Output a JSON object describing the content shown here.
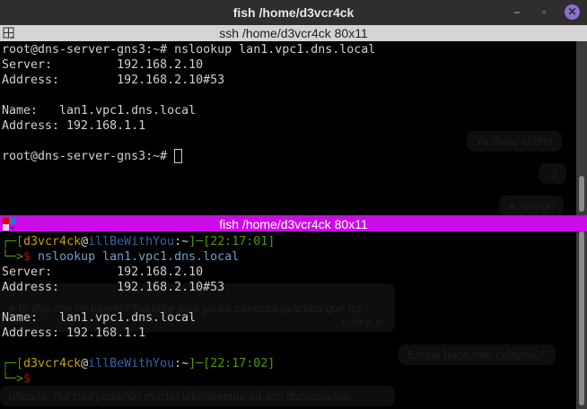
{
  "window": {
    "title": "fish /home/d3vcr4ck",
    "minimize": "–",
    "maximize": "▫",
    "close": "✕"
  },
  "top_pane": {
    "tab_title": "ssh /home/d3vcr4ck 80x11",
    "lines": [
      "root@dns-server-gns3:~# nslookup lan1.vpc1.dns.local",
      "Server:         192.168.2.10",
      "Address:        192.168.2.10#53",
      "",
      "Name:   lan1.vpc1.dns.local",
      "Address: 192.168.1.1",
      ""
    ],
    "prompt": "root@dns-server-gns3:~# "
  },
  "bottom_pane": {
    "tab_title": "fish /home/d3vcr4ck 80x11",
    "prompt1": {
      "corner": "┌─[",
      "user": "d3vcr4ck",
      "at": "@",
      "host": "illBeWithYou",
      "path": ":~",
      "mid": "]─[",
      "time": "22:17:01",
      "end": "]",
      "arrow": "└─>",
      "dollar": "$",
      "command": " nslookup lan1.vpc1.dns.local"
    },
    "lines": [
      "Server:         192.168.2.10",
      "Address:        192.168.2.10#53",
      "",
      "Name:   lan1.vpc1.dns.local",
      "Address: 192.168.1.1"
    ],
    "prompt2": {
      "corner": "┌─[",
      "user": "d3vcr4ck",
      "at": "@",
      "host": "illBeWithYou",
      "path": ":~",
      "mid": "]─[",
      "time": "22:17:02",
      "end": "]",
      "arrow": "└─>",
      "dollar": "$"
    }
  },
  "background_chat": [
    "Ya Salio el dns",
    ":3",
    "A rehago",
    "e te dije con mi momo? Nambre papi yo no conozco práctica que no",
    "10:04 p. m.",
    "Esque hace rato colapse :\"",
    "ntiendo, me rsta pasando mucho últimamente xd son demasiados"
  ]
}
